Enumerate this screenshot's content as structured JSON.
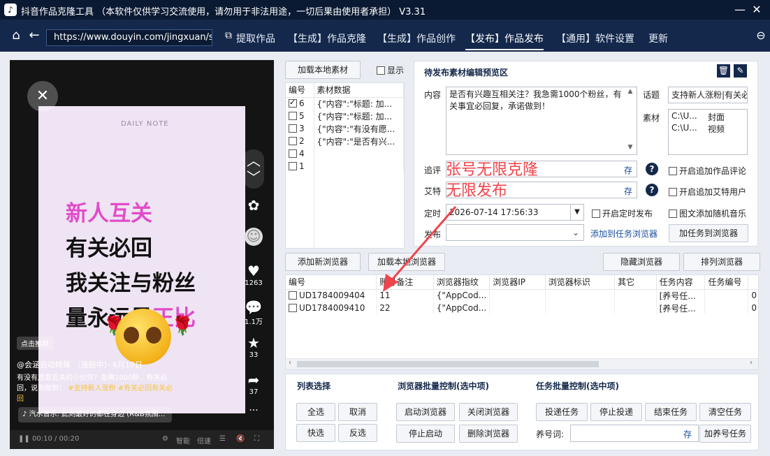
{
  "titlebar": {
    "title": "抖音作品克隆工具 （本软件仅供学习交流使用，请勿用于非法用途，一切后果由使用者承担） V3.31",
    "minimize": "—",
    "close": "✕"
  },
  "nav": {
    "url": "https://www.douyin.com/jingxuan/sea",
    "tabs": [
      "提取作品",
      "【生成】作品克隆",
      "【生成】作品创作",
      "【发布】作品发布",
      "【通用】软件设置",
      "更新"
    ]
  },
  "video": {
    "card_daily": "DAILY NOTE",
    "line1": "新人互关",
    "line2": "有关必回",
    "line3": "我关注与粉丝",
    "line4_a": "量永远是",
    "line4_b": "正比",
    "likes": "1263",
    "comments": "1.1万",
    "stars": "33",
    "shares": "37",
    "dots": "···",
    "pill": "点击推荐",
    "author": "@会涵自动特殊 （涨粉中）· 6月10日",
    "desc1": "有没有愿意互关的小伙伴？急需1000粉，有关必",
    "desc2": "回，说到做到！",
    "tag1": "#支持新人涨粉",
    "tag2": "#有关必回有关必",
    "desc3": "回",
    "music": "♪ 汽水音乐: 此刻最好的都在身边 (R&B氛围...",
    "time": "00:10 / 00:20",
    "ctrl_labels": [
      "智能",
      "倍速"
    ]
  },
  "material": {
    "load_button": "加载本地素材",
    "show_label": "显示",
    "col_num": "编号",
    "col_data": "素材数据",
    "rows": [
      {
        "num": "6",
        "checked": true,
        "data": "{\"内容\":\"标题: 加..."
      },
      {
        "num": "5",
        "checked": false,
        "data": "{\"内容\":\"标题: 加..."
      },
      {
        "num": "3",
        "checked": false,
        "data": "{\"内容\":\"有没有愿..."
      },
      {
        "num": "2",
        "checked": false,
        "data": "{\"内容\":\"是否有兴..."
      },
      {
        "num": "4",
        "checked": false,
        "data": ""
      },
      {
        "num": "1",
        "checked": false,
        "data": ""
      }
    ]
  },
  "editor": {
    "header": "待发布素材编辑预览区",
    "content_label": "内容",
    "content_value": "是否有兴趣互相关注？我急需1000个粉丝，有关事宜必回复，承诺做到！",
    "topic_label": "话题",
    "topic_value": "支持新人涨粉|有关必",
    "media_label": "素材",
    "media_rows": [
      [
        "C:\\U...",
        "封面"
      ],
      [
        "C:\\U...",
        "视频"
      ]
    ],
    "follow_label": "追评",
    "follow_overlay": "张号无限克隆",
    "store": "存",
    "at_label": "艾特",
    "at_overlay": "无限发布",
    "check_follow": "开启追加作品评论",
    "check_at": "开启追加艾特用户",
    "time_label": "定时",
    "time_value": "2026-07-14 17:56:33",
    "check_timed": "开启定时发布",
    "check_music": "图文添加随机音乐",
    "publish_label": "发布",
    "add_link": "添加到任务浏览器",
    "add_task_button": "加任务到浏览器"
  },
  "browser": {
    "add_button": "添加新浏览器",
    "load_button": "加载本地浏览器",
    "hide_button": "隐藏浏览器",
    "arrange_button": "排列浏览器",
    "columns": [
      "编号",
      "账号备注",
      "浏览器指纹",
      "浏览器IP",
      "浏览器标识",
      "其它",
      "任务内容",
      "任务编号",
      ""
    ],
    "rows": [
      [
        "UD1784009404",
        "11",
        "{\"AppCod...",
        "",
        "",
        "",
        "[养号任...",
        "",
        "0"
      ],
      [
        "UD1784009410",
        "22",
        "{\"AppCod...",
        "",
        "",
        "",
        "[养号任...",
        "",
        "0"
      ]
    ]
  },
  "bottom": {
    "list_select": "列表选择",
    "browser_ctrl": "浏览器批量控制(选中项)",
    "task_ctrl": "任务批量控制(选中项)",
    "select_all": "全选",
    "cancel": "取消",
    "quick_select": "快选",
    "invert": "反选",
    "start_browser": "启动浏览器",
    "close_browser": "关闭浏览器",
    "stop_start": "停止启动",
    "delete_browser": "删除浏览器",
    "deliver_task": "投递任务",
    "stop_deliver": "停止投递",
    "end_task": "结束任务",
    "clear_task": "清空任务",
    "nurture_label": "养号词:",
    "store": "存",
    "add_nurture": "加养号任务"
  }
}
